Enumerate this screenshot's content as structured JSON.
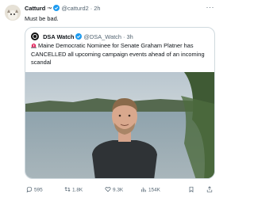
{
  "tweet": {
    "display_name": "Catturd",
    "tm": "™",
    "handle": "@catturd2",
    "separator": "·",
    "time": "2h",
    "text": "Must be bad."
  },
  "quoted": {
    "display_name": "DSA Watch",
    "handle": "@DSA_Watch",
    "separator": "·",
    "time": "3h",
    "text": "Maine Democratic Nominee for Senate Graham Platner has CANCELLED all upcoming campaign events ahead of an incoming scandal",
    "siren_icon": "siren-emoji"
  },
  "actions": {
    "replies": "595",
    "reposts": "1.8K",
    "likes": "9.3K",
    "views": "154K"
  },
  "colors": {
    "verified": "#1d9bf0",
    "muted": "#536471",
    "border": "#cfd9de"
  }
}
